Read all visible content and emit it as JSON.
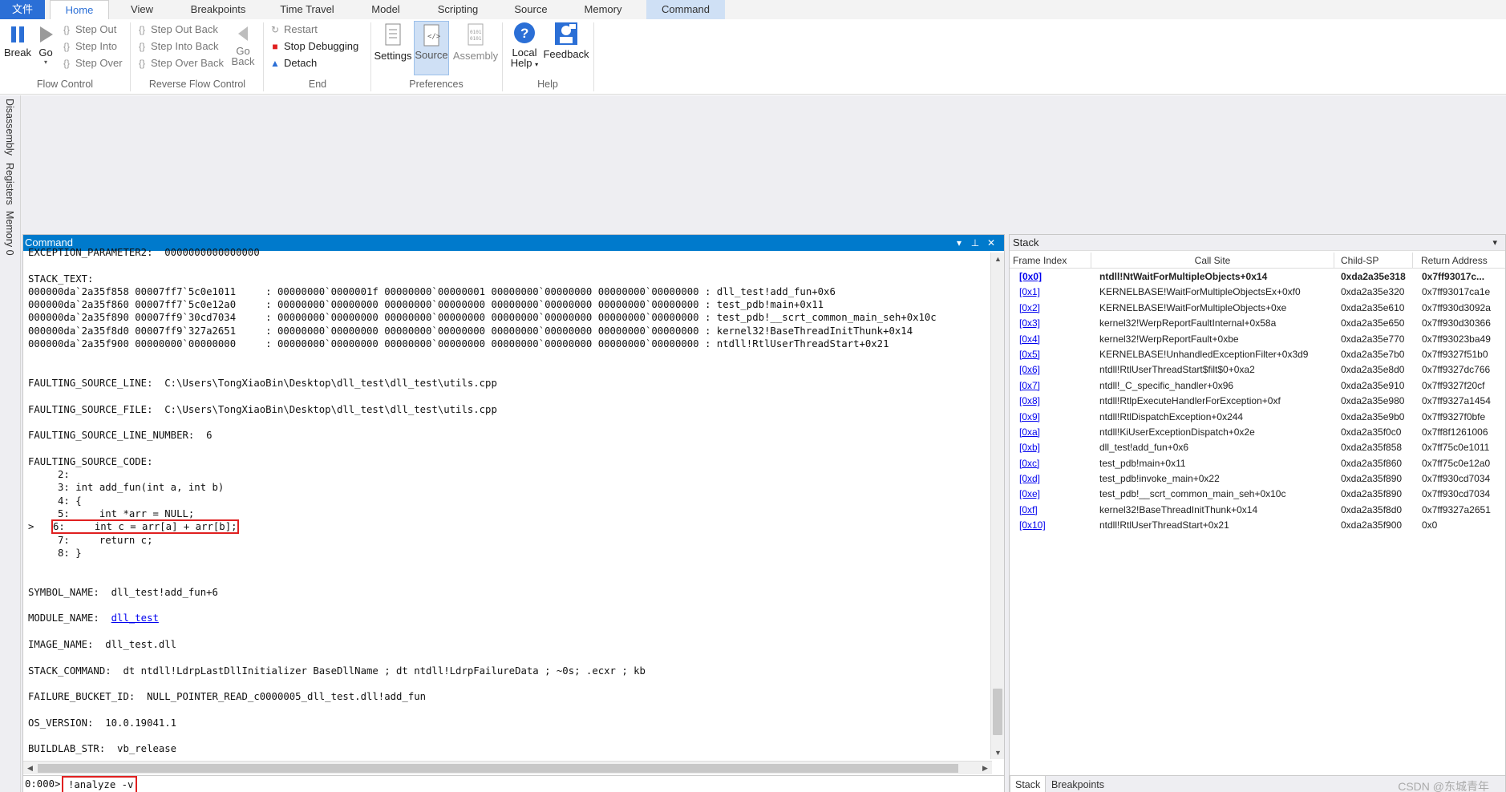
{
  "tabs": {
    "file": "文件",
    "home": "Home",
    "view": "View",
    "breakpoints": "Breakpoints",
    "time_travel": "Time Travel",
    "model": "Model",
    "scripting": "Scripting",
    "source": "Source",
    "memory": "Memory",
    "command": "Command"
  },
  "ribbon": {
    "break": "Break",
    "go": "Go",
    "step_out": "Step Out",
    "step_into": "Step Into",
    "step_over": "Step Over",
    "step_out_back": "Step Out Back",
    "step_into_back": "Step Into Back",
    "step_over_back": "Step Over Back",
    "go_back_1": "Go",
    "go_back_2": "Back",
    "restart": "Restart",
    "stop_debugging": "Stop Debugging",
    "detach": "Detach",
    "settings": "Settings",
    "source": "Source",
    "assembly": "Assembly",
    "local_help_1": "Local",
    "local_help_2": "Help",
    "feedback": "Feedback",
    "groups": {
      "flow_control": "Flow Control",
      "reverse_flow_control": "Reverse Flow Control",
      "end": "End",
      "preferences": "Preferences",
      "help": "Help"
    }
  },
  "left_tabs": {
    "disassembly": "Disassembly",
    "registers": "Registers",
    "memory0": "Memory 0"
  },
  "command_pane": {
    "title": "Command",
    "lines": [
      "EXCEPTION_PARAMETER2:  0000000000000000",
      "",
      "STACK_TEXT:",
      "000000da`2a35f858 00007ff7`5c0e1011     : 00000000`0000001f 00000000`00000001 00000000`00000000 00000000`00000000 : dll_test!add_fun+0x6",
      "000000da`2a35f860 00007ff7`5c0e12a0     : 00000000`00000000 00000000`00000000 00000000`00000000 00000000`00000000 : test_pdb!main+0x11",
      "000000da`2a35f890 00007ff9`30cd7034     : 00000000`00000000 00000000`00000000 00000000`00000000 00000000`00000000 : test_pdb!__scrt_common_main_seh+0x10c",
      "000000da`2a35f8d0 00007ff9`327a2651     : 00000000`00000000 00000000`00000000 00000000`00000000 00000000`00000000 : kernel32!BaseThreadInitThunk+0x14",
      "000000da`2a35f900 00000000`00000000     : 00000000`00000000 00000000`00000000 00000000`00000000 00000000`00000000 : ntdll!RtlUserThreadStart+0x21",
      "",
      "",
      "FAULTING_SOURCE_LINE:  C:\\Users\\TongXiaoBin\\Desktop\\dll_test\\dll_test\\utils.cpp",
      "",
      "FAULTING_SOURCE_FILE:  C:\\Users\\TongXiaoBin\\Desktop\\dll_test\\dll_test\\utils.cpp",
      "",
      "FAULTING_SOURCE_LINE_NUMBER:  6",
      "",
      "FAULTING_SOURCE_CODE:",
      "     2: ",
      "     3: int add_fun(int a, int b)",
      "     4: {",
      "     5:     int *arr = NULL;",
      "HIGHLIGHT",
      "     7:     return c;",
      "     8: }",
      "",
      "",
      "SYMBOL_NAME:  dll_test!add_fun+6",
      "",
      "MODULE_LINK",
      "",
      "IMAGE_NAME:  dll_test.dll",
      "",
      "STACK_COMMAND:  dt ntdll!LdrpLastDllInitializer BaseDllName ; dt ntdll!LdrpFailureData ; ~0s; .ecxr ; kb",
      "",
      "FAILURE_BUCKET_ID:  NULL_POINTER_READ_c0000005_dll_test.dll!add_fun",
      "",
      "OS_VERSION:  10.0.19041.1",
      "",
      "BUILDLAB_STR:  vb_release"
    ],
    "highlight_marker": ">",
    "highlight_line": "6:     int c = arr[a] + arr[b];",
    "module_label": "MODULE_NAME:  ",
    "module_link": "dll_test",
    "prompt": "0:000>",
    "input_value": "!analyze -v"
  },
  "stack_pane": {
    "title": "Stack",
    "headers": [
      "Frame Index",
      "Call Site",
      "Child-SP",
      "Return Address"
    ],
    "rows": [
      [
        "[0x0]",
        "ntdll!NtWaitForMultipleObjects+0x14",
        "0xda2a35e318",
        "0x7ff93017c..."
      ],
      [
        "[0x1]",
        "KERNELBASE!WaitForMultipleObjectsEx+0xf0",
        "0xda2a35e320",
        "0x7ff93017ca1e"
      ],
      [
        "[0x2]",
        "KERNELBASE!WaitForMultipleObjects+0xe",
        "0xda2a35e610",
        "0x7ff930d3092a"
      ],
      [
        "[0x3]",
        "kernel32!WerpReportFaultInternal+0x58a",
        "0xda2a35e650",
        "0x7ff930d30366"
      ],
      [
        "[0x4]",
        "kernel32!WerpReportFault+0xbe",
        "0xda2a35e770",
        "0x7ff93023ba49"
      ],
      [
        "[0x5]",
        "KERNELBASE!UnhandledExceptionFilter+0x3d9",
        "0xda2a35e7b0",
        "0x7ff9327f51b0"
      ],
      [
        "[0x6]",
        "ntdll!RtlUserThreadStart$filt$0+0xa2",
        "0xda2a35e8d0",
        "0x7ff9327dc766"
      ],
      [
        "[0x7]",
        "ntdll!_C_specific_handler+0x96",
        "0xda2a35e910",
        "0x7ff9327f20cf"
      ],
      [
        "[0x8]",
        "ntdll!RtlpExecuteHandlerForException+0xf",
        "0xda2a35e980",
        "0x7ff9327a1454"
      ],
      [
        "[0x9]",
        "ntdll!RtlDispatchException+0x244",
        "0xda2a35e9b0",
        "0x7ff9327f0bfe"
      ],
      [
        "[0xa]",
        "ntdll!KiUserExceptionDispatch+0x2e",
        "0xda2a35f0c0",
        "0x7ff8f1261006"
      ],
      [
        "[0xb]",
        "dll_test!add_fun+0x6",
        "0xda2a35f858",
        "0x7ff75c0e1011"
      ],
      [
        "[0xc]",
        "test_pdb!main+0x11",
        "0xda2a35f860",
        "0x7ff75c0e12a0"
      ],
      [
        "[0xd]",
        "test_pdb!invoke_main+0x22",
        "0xda2a35f890",
        "0x7ff930cd7034"
      ],
      [
        "[0xe]",
        "test_pdb!__scrt_common_main_seh+0x10c",
        "0xda2a35f890",
        "0x7ff930cd7034"
      ],
      [
        "[0xf]",
        "kernel32!BaseThreadInitThunk+0x14",
        "0xda2a35f8d0",
        "0x7ff9327a2651"
      ],
      [
        "[0x10]",
        "ntdll!RtlUserThreadStart+0x21",
        "0xda2a35f900",
        "0x0"
      ]
    ],
    "bottom_tabs": [
      "Stack",
      "Breakpoints"
    ],
    "watermark": "CSDN @东城青年"
  }
}
